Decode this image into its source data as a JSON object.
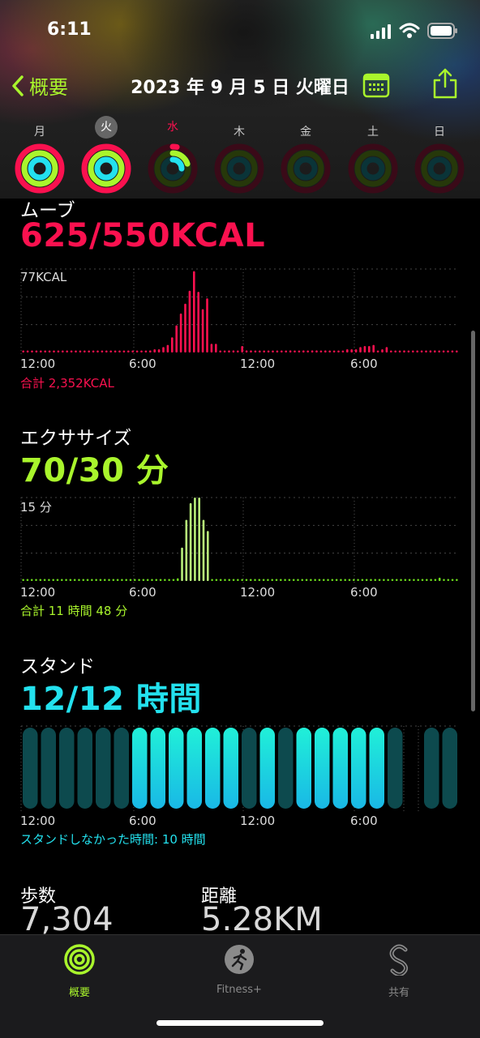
{
  "status": {
    "time": "6:11"
  },
  "nav": {
    "back_label": "概要",
    "title": "2023 年 9 月 5 日 火曜日"
  },
  "week": {
    "days": [
      "月",
      "火",
      "水",
      "木",
      "金",
      "土",
      "日"
    ],
    "selected_index": 1,
    "today_index": 2,
    "rings": [
      {
        "move": 1.0,
        "exercise": 1.0,
        "stand": 1.0
      },
      {
        "move": 1.0,
        "exercise": 1.0,
        "stand": 1.0
      },
      {
        "move": 0.03,
        "exercise": 0.2,
        "stand": 0.25
      },
      {
        "move": 0,
        "exercise": 0,
        "stand": 0
      },
      {
        "move": 0,
        "exercise": 0,
        "stand": 0
      },
      {
        "move": 0,
        "exercise": 0,
        "stand": 0
      },
      {
        "move": 0,
        "exercise": 0,
        "stand": 0
      }
    ]
  },
  "colors": {
    "move": "#fa114f",
    "exercise": "#a9f52c",
    "stand": "#23e1ee",
    "accent": "#a9f52c"
  },
  "move": {
    "title": "ムーブ",
    "value": "625/550KCAL",
    "max_label": "77KCAL",
    "x_ticks": [
      "12:00",
      "6:00",
      "12:00",
      "6:00"
    ],
    "total": "合計 2,352KCAL",
    "chart_data": {
      "type": "bar",
      "y_max": 77,
      "values": [
        0.5,
        0.5,
        0.5,
        0.5,
        0.5,
        0.5,
        0.5,
        0.5,
        0.5,
        0.5,
        0.5,
        0.5,
        0.5,
        0.5,
        0.5,
        0.5,
        0.5,
        0.5,
        0.5,
        0.5,
        0.5,
        0.5,
        0.5,
        0.5,
        1,
        1,
        1,
        1.5,
        1.5,
        2,
        3,
        3,
        5,
        7,
        14,
        25,
        36,
        45,
        57,
        75,
        56,
        40,
        50,
        8,
        8,
        1,
        1,
        2,
        2,
        1,
        6,
        2,
        2,
        1,
        1,
        1,
        1,
        1,
        1,
        1,
        1,
        2,
        1,
        1,
        2,
        1,
        2,
        2,
        1,
        2,
        1,
        1,
        1,
        1,
        3,
        3,
        3,
        5,
        6,
        6,
        7,
        1,
        3,
        5,
        1,
        1,
        1,
        2,
        1,
        1,
        1,
        1,
        1,
        2,
        2,
        1,
        1,
        1,
        1,
        1
      ]
    }
  },
  "exercise": {
    "title": "エクササイズ",
    "value": "70/30 分",
    "max_label": "15 分",
    "x_ticks": [
      "12:00",
      "6:00",
      "12:00",
      "6:00"
    ],
    "total": "合計 11 時間 48 分",
    "chart_data": {
      "type": "bar",
      "y_max": 15,
      "values": [
        0,
        0,
        0,
        0,
        0,
        0,
        0,
        0,
        0,
        0,
        0,
        0,
        0,
        0,
        0,
        0,
        0,
        0,
        0,
        0,
        0,
        0,
        0,
        0,
        0,
        0,
        0,
        0,
        0,
        0,
        0,
        0,
        0,
        0,
        0,
        0,
        0.5,
        6,
        11,
        14,
        15,
        15,
        11,
        9,
        0,
        0,
        0,
        0,
        0,
        0,
        0,
        0,
        0,
        0,
        0,
        0,
        0,
        0,
        0,
        0,
        0,
        0,
        0,
        0,
        0,
        0,
        0,
        0,
        0,
        0,
        0,
        0,
        0,
        0,
        0,
        0,
        0,
        0,
        0,
        0,
        0,
        0,
        0,
        0,
        0,
        0,
        0,
        0,
        0,
        0,
        0,
        0,
        0,
        0,
        0,
        0,
        0,
        0.6,
        0,
        0,
        0,
        0
      ]
    }
  },
  "stand": {
    "title": "スタンド",
    "value": "12/12 時間",
    "x_ticks": [
      "12:00",
      "6:00",
      "12:00",
      "6:00"
    ],
    "total": "スタンドしなかった時間: 10 時間",
    "chart_data": {
      "type": "bar",
      "hours": [
        0,
        0,
        0,
        0,
        0,
        0,
        1,
        1,
        1,
        1,
        1,
        1,
        0,
        1,
        0,
        1,
        1,
        1,
        1,
        1,
        0,
        -1,
        0,
        0
      ],
      "note": "1 = stood, 0 = did not stand, -1 = no data"
    }
  },
  "steps": {
    "label": "歩数",
    "value": "7,304"
  },
  "distance": {
    "label": "距離",
    "value": "5.28KM"
  },
  "tabs": [
    {
      "label": "概要",
      "active": true
    },
    {
      "label": "Fitness+",
      "active": false
    },
    {
      "label": "共有",
      "active": false
    }
  ]
}
